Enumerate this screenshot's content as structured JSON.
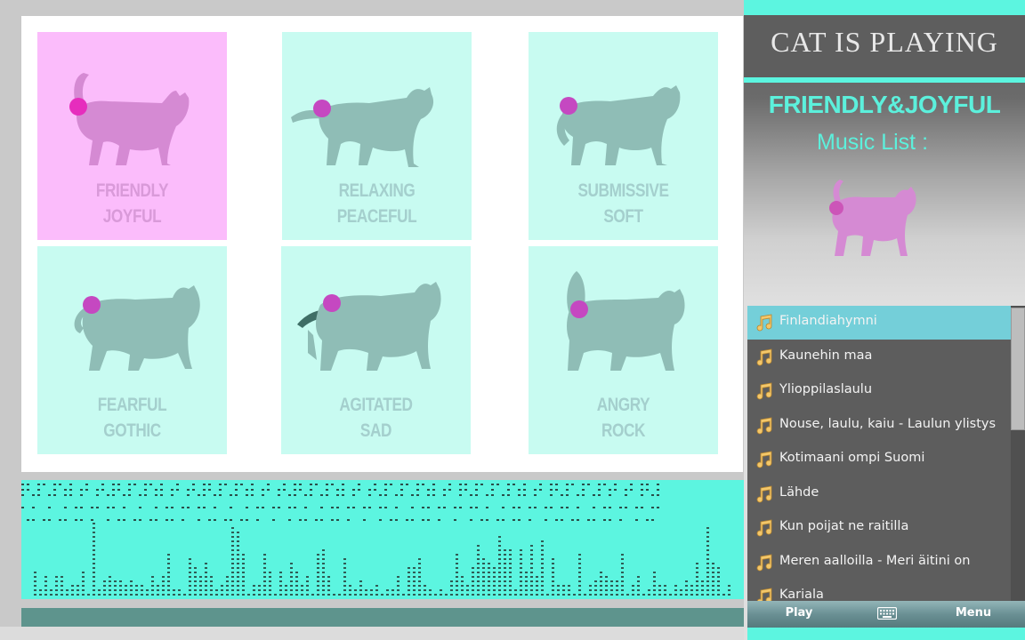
{
  "app": {
    "title": "CAT IS PLAYING"
  },
  "colors": {
    "accent": "#5cf5e0",
    "active_card": "#fbbcfb",
    "card": "#c8fbf1",
    "cat_dark": "#8fbdb6",
    "cat_active": "#d58ad3",
    "dot": "#e040c8"
  },
  "moods": [
    {
      "id": "friendly",
      "line1": "FRIENDLY",
      "line2": "JOYFUL",
      "active": true
    },
    {
      "id": "relaxing",
      "line1": "RELAXING",
      "line2": "PEACEFUL",
      "active": false
    },
    {
      "id": "submissive",
      "line1": "SUBMISSIVE",
      "line2": "SOFT",
      "active": false
    },
    {
      "id": "fearful",
      "line1": "FEARFUL",
      "line2": "GOTHIC",
      "active": false
    },
    {
      "id": "agitated",
      "line1": "AGITATED",
      "line2": "SAD",
      "active": false
    },
    {
      "id": "angry",
      "line1": "ANGRY",
      "line2": "ROCK",
      "active": false
    }
  ],
  "side": {
    "mood_name": "FRIENDLY&JOYFUL",
    "music_list_label": "Music List :"
  },
  "playlist": {
    "selected_index": 0,
    "tracks": [
      "Finlandiahymni",
      "Kaunehin maa",
      "Ylioppilaslaulu",
      "Nouse, laulu, kaiu - Laulun ylistys",
      "Kotimaani ompi Suomi",
      "Lähde",
      "Kun poijat ne raitilla",
      "Meren aalloilla - Meri äitini on",
      "Kariala"
    ]
  },
  "softkeys": {
    "left": "Play",
    "right": "Menu"
  },
  "icons": {
    "track": "music-note-icon",
    "keyboard": "keyboard-icon"
  }
}
